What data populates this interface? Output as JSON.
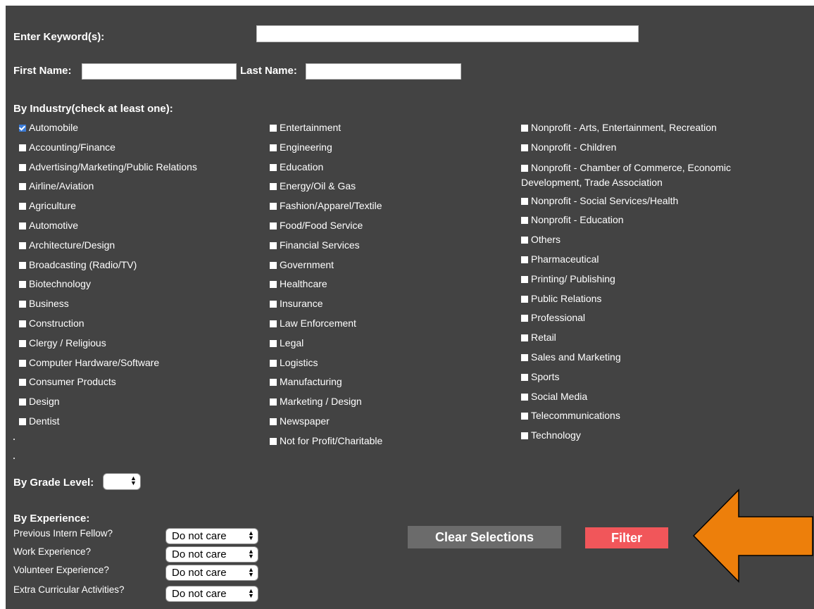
{
  "form": {
    "keyword_label": "Enter Keyword(s):",
    "keyword_value": "",
    "first_name_label": "First Name:",
    "first_name_value": "",
    "last_name_label": "Last Name:",
    "last_name_value": ""
  },
  "industry": {
    "heading": "By Industry(check at least one):",
    "col1": [
      {
        "label": "Automobile",
        "checked": true
      },
      {
        "label": "Accounting/Finance",
        "checked": false
      },
      {
        "label": "Advertising/Marketing/Public Relations",
        "checked": false
      },
      {
        "label": "Airline/Aviation",
        "checked": false
      },
      {
        "label": "Agriculture",
        "checked": false
      },
      {
        "label": "Automotive",
        "checked": false
      },
      {
        "label": "Architecture/Design",
        "checked": false
      },
      {
        "label": "Broadcasting (Radio/TV)",
        "checked": false
      },
      {
        "label": "Biotechnology",
        "checked": false
      },
      {
        "label": "Business",
        "checked": false
      },
      {
        "label": "Construction",
        "checked": false
      },
      {
        "label": "Clergy / Religious",
        "checked": false
      },
      {
        "label": "Computer Hardware/Software",
        "checked": false
      },
      {
        "label": "Consumer Products",
        "checked": false
      },
      {
        "label": "Design",
        "checked": false
      },
      {
        "label": "Dentist",
        "checked": false
      }
    ],
    "col2": [
      {
        "label": "Entertainment",
        "checked": false
      },
      {
        "label": "Engineering",
        "checked": false
      },
      {
        "label": "Education",
        "checked": false
      },
      {
        "label": "Energy/Oil & Gas",
        "checked": false
      },
      {
        "label": "Fashion/Apparel/Textile",
        "checked": false
      },
      {
        "label": "Food/Food Service",
        "checked": false
      },
      {
        "label": "Financial Services",
        "checked": false
      },
      {
        "label": "Government",
        "checked": false
      },
      {
        "label": "Healthcare",
        "checked": false
      },
      {
        "label": "Insurance",
        "checked": false
      },
      {
        "label": "Law Enforcement",
        "checked": false
      },
      {
        "label": "Legal",
        "checked": false
      },
      {
        "label": "Logistics",
        "checked": false
      },
      {
        "label": "Manufacturing",
        "checked": false
      },
      {
        "label": "Marketing / Design",
        "checked": false
      },
      {
        "label": "Newspaper",
        "checked": false
      },
      {
        "label": "Not for Profit/Charitable",
        "checked": false
      }
    ],
    "col3": [
      {
        "label": "Nonprofit - Arts, Entertainment, Recreation",
        "checked": false
      },
      {
        "label": "Nonprofit - Children",
        "checked": false
      },
      {
        "label": "Nonprofit - Chamber of Commerce, Economic Development, Trade Association",
        "checked": false
      },
      {
        "label": "Nonprofit - Social Services/Health",
        "checked": false
      },
      {
        "label": "Nonprofit - Education",
        "checked": false
      },
      {
        "label": "Others",
        "checked": false
      },
      {
        "label": "Pharmaceutical",
        "checked": false
      },
      {
        "label": "Printing/ Publishing",
        "checked": false
      },
      {
        "label": "Public Relations",
        "checked": false
      },
      {
        "label": "Professional",
        "checked": false
      },
      {
        "label": "Retail",
        "checked": false
      },
      {
        "label": "Sales and Marketing",
        "checked": false
      },
      {
        "label": "Sports",
        "checked": false
      },
      {
        "label": "Social Media",
        "checked": false
      },
      {
        "label": "Telecommunications",
        "checked": false
      },
      {
        "label": "Technology",
        "checked": false
      }
    ]
  },
  "grade": {
    "label": "By Grade Level:",
    "selected": ""
  },
  "experience": {
    "heading": "By Experience:",
    "rows": [
      {
        "label": "Previous Intern Fellow?",
        "value": "Do not care"
      },
      {
        "label": "Work Experience?",
        "value": "Do not care"
      },
      {
        "label": "Volunteer Experience?",
        "value": "Do not care"
      },
      {
        "label": "Extra Curricular Activities?",
        "value": "Do not care"
      }
    ]
  },
  "buttons": {
    "clear_label": "Clear Selections",
    "filter_label": "Filter"
  },
  "colors": {
    "panel_bg": "#434343",
    "clear_button": "#6b6b6b",
    "filter_button": "#f1565a",
    "arrow": "#ed7f0b"
  },
  "icons": {
    "select_arrows": "updown-chevron-icon",
    "callout": "left-arrow-icon"
  }
}
